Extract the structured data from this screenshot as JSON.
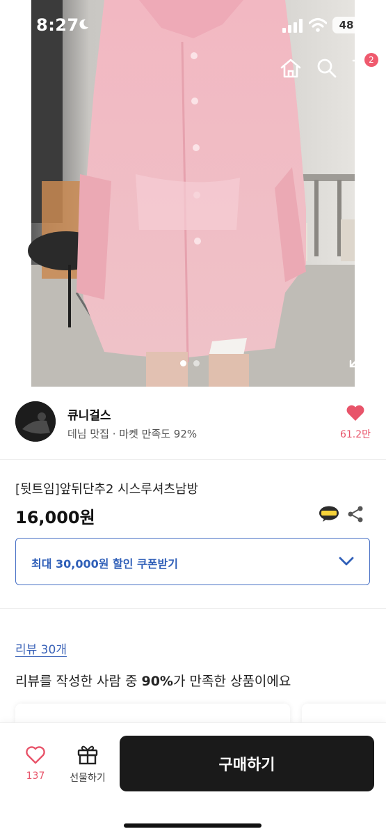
{
  "status_bar": {
    "time": "8:27",
    "battery": "48"
  },
  "nav": {
    "cart_badge": "2"
  },
  "gallery": {
    "image_count": 2,
    "active_index": 0
  },
  "seller": {
    "name": "큐니걸스",
    "subtitle": "데님 맛집 · 마켓 만족도 92%",
    "likes": "61.2만"
  },
  "product": {
    "title": "[뒷트임]앞뒤단추2 시스루셔츠남방",
    "price": "16,000원",
    "coupon_label": "최대 30,000원 할인 쿠폰받기"
  },
  "reviews": {
    "link_label": "리뷰 30개",
    "summary_prefix": "리뷰를 작성한 사람 중 ",
    "summary_highlight": "90%",
    "summary_suffix": "가 만족한 상품이에요"
  },
  "bottom_bar": {
    "wish_count": "137",
    "gift_label": "선물하기",
    "buy_label": "구매하기"
  },
  "colors": {
    "accent_pink": "#e8546a",
    "coupon_blue": "#2f5fb8",
    "buy_button": "#1a1a1a"
  },
  "icons": [
    "back-icon",
    "home-icon",
    "search-icon",
    "cart-icon",
    "expand-icon",
    "heart-icon",
    "kakaotalk-icon",
    "share-icon",
    "chevron-down-icon",
    "gift-icon"
  ]
}
